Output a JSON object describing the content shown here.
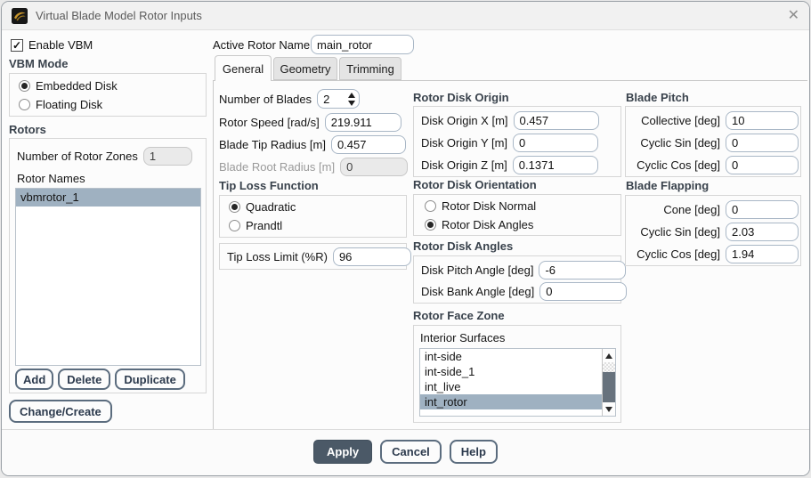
{
  "window": {
    "title": "Virtual Blade Model Rotor Inputs",
    "close_glyph": "✕"
  },
  "colors": {
    "selection": "#9fb1c1",
    "apply_button": "#4b5967",
    "heading_text": "#39424c",
    "input_border": "#a9b7c6"
  },
  "left_panel": {
    "enable_vbm_label": "Enable VBM",
    "enable_vbm_check": "✓",
    "vbm_mode": {
      "heading": "VBM Mode",
      "options": [
        {
          "label": "Embedded Disk",
          "selected": true
        },
        {
          "label": "Floating Disk",
          "selected": false
        }
      ]
    },
    "rotors": {
      "heading": "Rotors",
      "zones_label": "Number of Rotor Zones",
      "zones_value": "1",
      "names_label": "Rotor Names",
      "names": [
        "vbmrotor_1"
      ],
      "selected_name": "vbmrotor_1",
      "add_label": "Add",
      "delete_label": "Delete",
      "duplicate_label": "Duplicate"
    },
    "change_create_label": "Change/Create"
  },
  "header": {
    "active_rotor_label": "Active Rotor Name",
    "active_rotor_value": "main_rotor"
  },
  "tabs": {
    "items": [
      {
        "label": "General"
      },
      {
        "label": "Geometry"
      },
      {
        "label": "Trimming"
      }
    ],
    "active": "General"
  },
  "general_tab": {
    "number_of_blades": {
      "label": "Number of Blades",
      "value": "2"
    },
    "rotor_speed": {
      "label": "Rotor Speed [rad/s]",
      "value": "219.911"
    },
    "blade_tip_radius": {
      "label": "Blade Tip Radius [m]",
      "value": "0.457"
    },
    "blade_root_radius": {
      "label": "Blade Root Radius [m]",
      "value": "0",
      "disabled": true
    },
    "tip_loss_function": {
      "heading": "Tip Loss Function",
      "options": [
        {
          "label": "Quadratic",
          "selected": true
        },
        {
          "label": "Prandtl",
          "selected": false
        }
      ]
    },
    "tip_loss_limit": {
      "label": "Tip Loss Limit (%R)",
      "value": "96"
    },
    "rotor_disk_origin": {
      "heading": "Rotor Disk Origin",
      "fields": [
        {
          "label": "Disk Origin X [m]",
          "value": "0.457"
        },
        {
          "label": "Disk Origin Y [m]",
          "value": "0"
        },
        {
          "label": "Disk Origin Z [m]",
          "value": "0.1371"
        }
      ]
    },
    "rotor_disk_orientation": {
      "heading": "Rotor Disk Orientation",
      "options": [
        {
          "label": "Rotor Disk Normal",
          "selected": false
        },
        {
          "label": "Rotor Disk Angles",
          "selected": true
        }
      ]
    },
    "rotor_disk_angles": {
      "heading": "Rotor Disk Angles",
      "fields": [
        {
          "label": "Disk Pitch Angle [deg]",
          "value": "-6"
        },
        {
          "label": "Disk Bank Angle [deg]",
          "value": "0"
        }
      ]
    },
    "rotor_face_zone": {
      "heading": "Rotor Face Zone",
      "surfaces_label": "Interior Surfaces",
      "items": [
        "int-side",
        "int-side_1",
        "int_live",
        "int_rotor"
      ],
      "selected": "int_rotor"
    },
    "blade_pitch": {
      "heading": "Blade Pitch",
      "fields": [
        {
          "label": "Collective [deg]",
          "value": "10"
        },
        {
          "label": "Cyclic Sin [deg]",
          "value": "0"
        },
        {
          "label": "Cyclic Cos [deg]",
          "value": "0"
        }
      ]
    },
    "blade_flapping": {
      "heading": "Blade Flapping",
      "fields": [
        {
          "label": "Cone [deg]",
          "value": "0"
        },
        {
          "label": "Cyclic Sin [deg]",
          "value": "2.03"
        },
        {
          "label": "Cyclic Cos [deg]",
          "value": "1.94"
        }
      ]
    }
  },
  "footer": {
    "apply_label": "Apply",
    "cancel_label": "Cancel",
    "help_label": "Help"
  }
}
